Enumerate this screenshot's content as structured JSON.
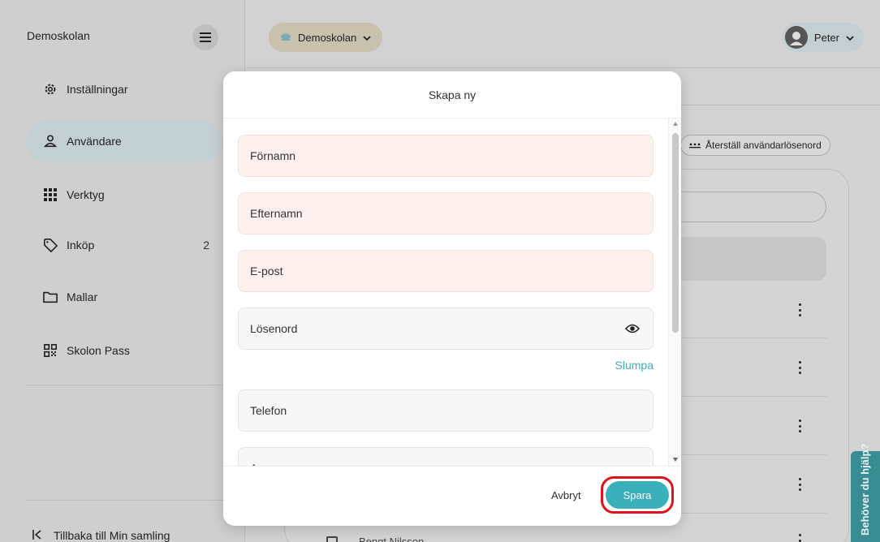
{
  "sidebar": {
    "title": "Demoskolan",
    "items": [
      {
        "label": "Inställningar",
        "icon": "gear-icon"
      },
      {
        "label": "Användare",
        "icon": "user-icon",
        "active": true
      },
      {
        "label": "Verktyg",
        "icon": "grid-icon"
      },
      {
        "label": "Inköp",
        "icon": "tag-icon",
        "badge": "2"
      },
      {
        "label": "Mallar",
        "icon": "folder-icon"
      },
      {
        "label": "Skolon Pass",
        "icon": "qr-code-icon"
      }
    ],
    "back_label": "Tillbaka till Min samling"
  },
  "topbar": {
    "school_label": "Demoskolan",
    "user_name": "Peter"
  },
  "background": {
    "reset_password_label": "Återställ användarlösenord",
    "partial_row_name": "Bengt Nilsson"
  },
  "help_tab": {
    "label": "Behöver du hjälp?"
  },
  "modal": {
    "title": "Skapa ny",
    "fields": {
      "first_name": "Förnamn",
      "last_name": "Efternamn",
      "email": "E-post",
      "password": "Lösenord",
      "phone": "Telefon",
      "partial": "A"
    },
    "randomize_label": "Slumpa",
    "cancel_label": "Avbryt",
    "save_label": "Spara"
  },
  "colors": {
    "accent": "#3ab0ba",
    "highlight": "#e0121c",
    "required_field_bg": "#fdf0ef"
  }
}
